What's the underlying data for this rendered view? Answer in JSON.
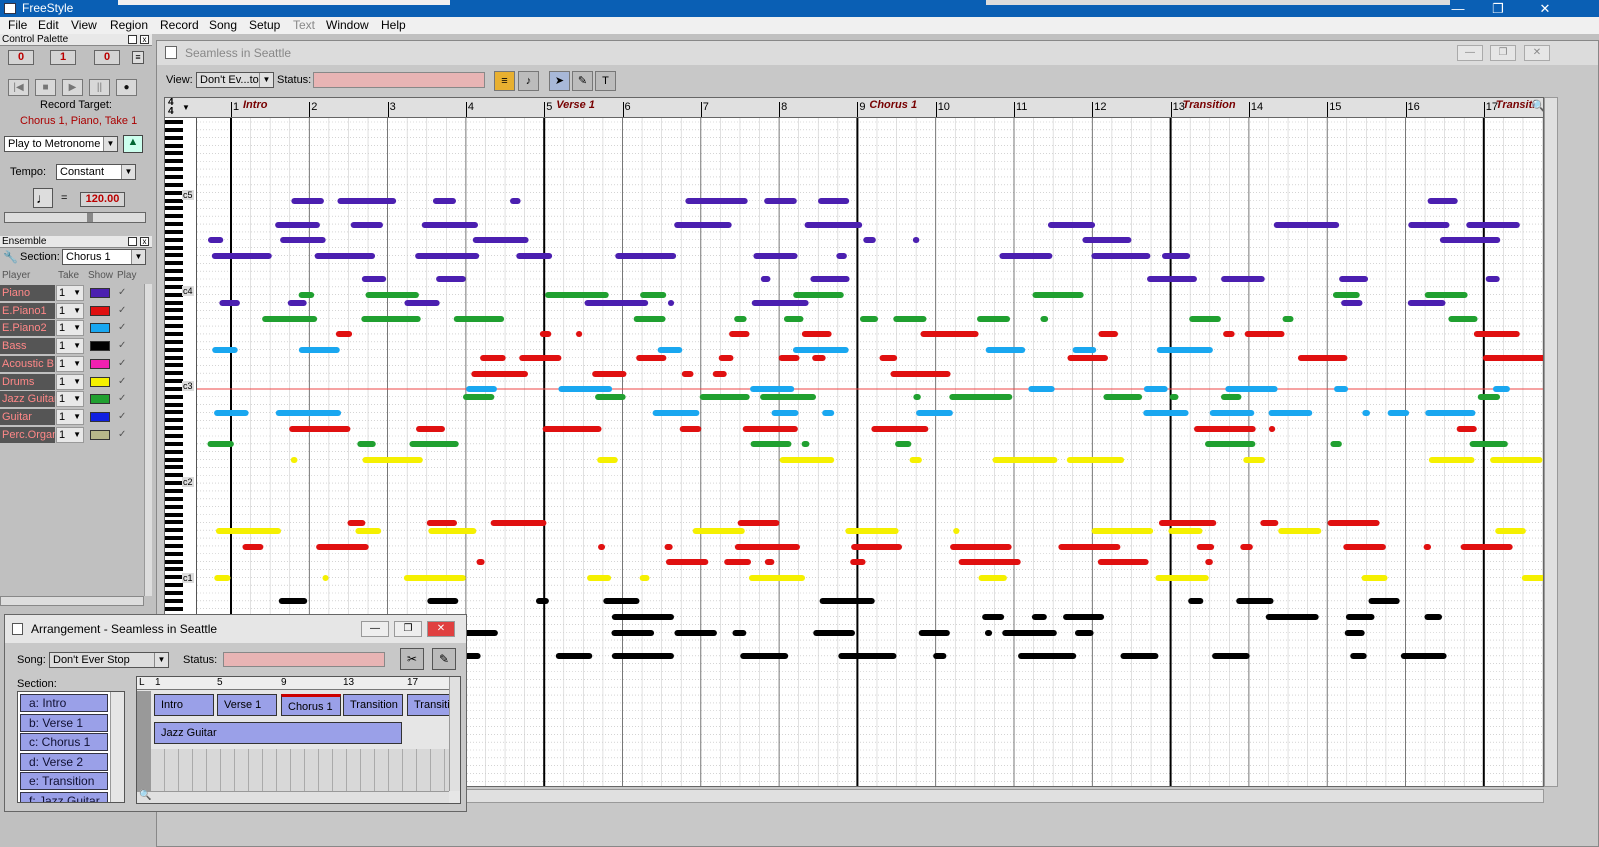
{
  "app": {
    "title": "FreeStyle",
    "menu": [
      "File",
      "Edit",
      "View",
      "Region",
      "Record",
      "Song",
      "Setup",
      "Text",
      "Window",
      "Help"
    ],
    "menu_disabled": [
      "Text"
    ]
  },
  "control_palette": {
    "title": "Control Palette",
    "counter": [
      "0",
      "1",
      "0"
    ],
    "record_target_label": "Record Target:",
    "record_target_value": "Chorus 1, Piano, Take 1",
    "sync_mode": "Play to Metronome",
    "tempo_label": "Tempo:",
    "tempo_mode": "Constant",
    "tempo_equals": "=",
    "tempo_value": "120.00"
  },
  "ensemble": {
    "title": "Ensemble",
    "section_label": "Section:",
    "section_value": "Chorus 1",
    "columns": [
      "Player",
      "Take",
      "Show",
      "Play"
    ],
    "players": [
      {
        "name": "Piano",
        "take": "1",
        "color": "#4b1fb0"
      },
      {
        "name": "E.Piano1",
        "take": "1",
        "color": "#e01010"
      },
      {
        "name": "E.Piano2",
        "take": "1",
        "color": "#19a7f0"
      },
      {
        "name": "Bass",
        "take": "1",
        "color": "#000000"
      },
      {
        "name": "Acoustic B",
        "take": "1",
        "color": "#f020b0"
      },
      {
        "name": "Drums",
        "take": "1",
        "color": "#f5f000"
      },
      {
        "name": "Jazz Guitar",
        "take": "1",
        "color": "#20a030"
      },
      {
        "name": "Guitar",
        "take": "1",
        "color": "#1020e0"
      },
      {
        "name": "Perc.Organ",
        "take": "1",
        "color": "#b8b88a"
      }
    ]
  },
  "document": {
    "title": "Seamless in Seattle",
    "view_label": "View:",
    "view_value": "Don't Ev...top",
    "status_label": "Status:",
    "time_signature": [
      "4",
      "4"
    ],
    "bars": [
      "1",
      "2",
      "3",
      "4",
      "5",
      "6",
      "7",
      "8",
      "9",
      "10",
      "11",
      "12",
      "13",
      "14",
      "15",
      "16",
      "17"
    ],
    "sections": [
      {
        "bar": 1,
        "name": "Intro"
      },
      {
        "bar": 5,
        "name": "Verse 1"
      },
      {
        "bar": 9,
        "name": "Chorus 1"
      },
      {
        "bar": 13,
        "name": "Transition"
      },
      {
        "bar": 17,
        "name": "Transiti"
      }
    ],
    "octave_labels": [
      "c5",
      "c4",
      "c3",
      "c2",
      "c1"
    ]
  },
  "arrangement": {
    "title": "Arrangement - Seamless in Seattle",
    "song_label": "Song:",
    "song_value": "Don't Ever Stop",
    "status_label": "Status:",
    "section_label": "Section:",
    "sections": [
      "a: Intro",
      "b: Verse 1",
      "c: Chorus 1",
      "d: Verse 2",
      "e: Transition",
      "f: Jazz Guitar"
    ],
    "ruler": [
      "L",
      "1",
      "5",
      "9",
      "13",
      "17"
    ],
    "blocks": [
      "Intro",
      "Verse 1",
      "Chorus 1",
      "Transition",
      "Transiti"
    ],
    "guitar_block": "Jazz Guitar"
  }
}
